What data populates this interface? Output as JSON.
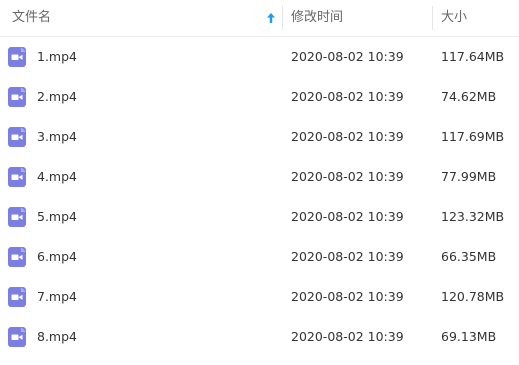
{
  "colors": {
    "icon": "#7b7fe3",
    "sort_arrow": "#1e9bef",
    "header_text": "#666666",
    "row_text": "#333333"
  },
  "header": {
    "name": "文件名",
    "modified": "修改时间",
    "size": "大小",
    "sort_icon": "arrow-up-icon"
  },
  "files": [
    {
      "name": "1.mp4",
      "modified": "2020-08-02 10:39",
      "size": "117.64MB",
      "icon": "video-file-icon"
    },
    {
      "name": "2.mp4",
      "modified": "2020-08-02 10:39",
      "size": "74.62MB",
      "icon": "video-file-icon"
    },
    {
      "name": "3.mp4",
      "modified": "2020-08-02 10:39",
      "size": "117.69MB",
      "icon": "video-file-icon"
    },
    {
      "name": "4.mp4",
      "modified": "2020-08-02 10:39",
      "size": "77.99MB",
      "icon": "video-file-icon"
    },
    {
      "name": "5.mp4",
      "modified": "2020-08-02 10:39",
      "size": "123.32MB",
      "icon": "video-file-icon"
    },
    {
      "name": "6.mp4",
      "modified": "2020-08-02 10:39",
      "size": "66.35MB",
      "icon": "video-file-icon"
    },
    {
      "name": "7.mp4",
      "modified": "2020-08-02 10:39",
      "size": "120.78MB",
      "icon": "video-file-icon"
    },
    {
      "name": "8.mp4",
      "modified": "2020-08-02 10:39",
      "size": "69.13MB",
      "icon": "video-file-icon"
    }
  ]
}
